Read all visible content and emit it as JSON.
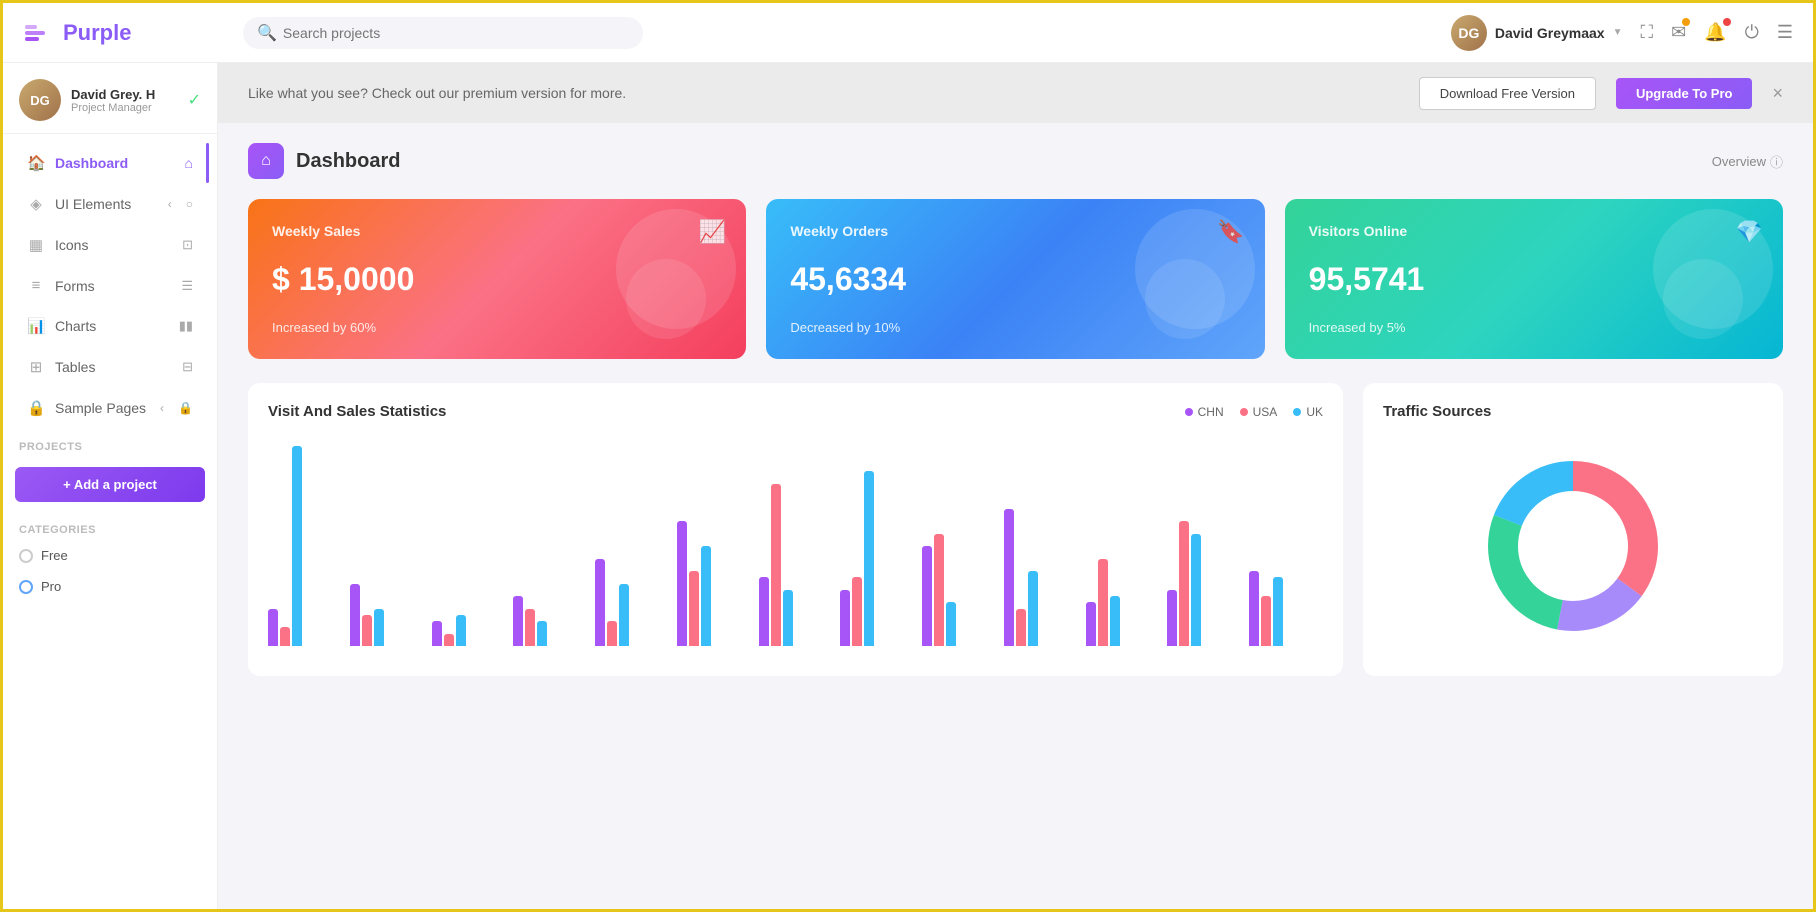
{
  "app": {
    "name": "Purple",
    "tagline": "Dashboard"
  },
  "topbar": {
    "search_placeholder": "Search projects",
    "user": {
      "name": "David Greymaax",
      "initials": "DG"
    },
    "icons": [
      "expand",
      "mail",
      "bell",
      "power",
      "menu"
    ]
  },
  "sidebar": {
    "user": {
      "name": "David Grey. H",
      "role": "Project Manager",
      "initials": "DG"
    },
    "nav_items": [
      {
        "label": "Dashboard",
        "icon": "🏠",
        "active": true
      },
      {
        "label": "UI Elements",
        "icon": "◈",
        "has_arrow": true
      },
      {
        "label": "Icons",
        "icon": "▦"
      },
      {
        "label": "Forms",
        "icon": "≡"
      },
      {
        "label": "Charts",
        "icon": "📊"
      },
      {
        "label": "Tables",
        "icon": "⊞"
      },
      {
        "label": "Sample Pages",
        "icon": "🔒",
        "has_arrow": true
      }
    ],
    "projects_label": "Projects",
    "add_project_label": "+ Add a project",
    "categories_label": "Categories",
    "categories": [
      {
        "label": "Free",
        "type": "radio"
      },
      {
        "label": "Pro",
        "type": "radio-blue"
      }
    ]
  },
  "banner": {
    "text": "Like what you see? Check out our premium version for more.",
    "download_label": "Download Free Version",
    "upgrade_label": "Upgrade To Pro"
  },
  "dashboard": {
    "title": "Dashboard",
    "overview_label": "Overview",
    "stat_cards": [
      {
        "label": "Weekly Sales",
        "value": "$ 15,0000",
        "change": "Increased by 60%",
        "color": "pink",
        "icon": "📈"
      },
      {
        "label": "Weekly Orders",
        "value": "45,6334",
        "change": "Decreased by 10%",
        "color": "blue",
        "icon": "🔖"
      },
      {
        "label": "Visitors Online",
        "value": "95,5741",
        "change": "Increased by 5%",
        "color": "teal",
        "icon": "💎"
      }
    ],
    "visit_stats": {
      "title": "Visit And Sales Statistics",
      "legend": [
        {
          "label": "CHN",
          "color": "#a855f7"
        },
        {
          "label": "USA",
          "color": "#fb7185"
        },
        {
          "label": "UK",
          "color": "#38bdf8"
        }
      ],
      "bars": [
        {
          "chn": 30,
          "usa": 15,
          "uk": 160
        },
        {
          "chn": 50,
          "usa": 25,
          "uk": 30
        },
        {
          "chn": 20,
          "usa": 10,
          "uk": 25
        },
        {
          "chn": 40,
          "usa": 30,
          "uk": 20
        },
        {
          "chn": 70,
          "usa": 20,
          "uk": 50
        },
        {
          "chn": 100,
          "usa": 60,
          "uk": 80
        },
        {
          "chn": 55,
          "usa": 130,
          "uk": 45
        },
        {
          "chn": 45,
          "usa": 55,
          "uk": 140
        },
        {
          "chn": 80,
          "usa": 90,
          "uk": 35
        },
        {
          "chn": 110,
          "usa": 30,
          "uk": 60
        },
        {
          "chn": 35,
          "usa": 70,
          "uk": 40
        },
        {
          "chn": 45,
          "usa": 100,
          "uk": 90
        },
        {
          "chn": 60,
          "usa": 40,
          "uk": 55
        }
      ]
    },
    "traffic_sources": {
      "title": "Traffic Sources",
      "segments": [
        {
          "color": "#fb7185",
          "percent": 35
        },
        {
          "color": "#a78bfa",
          "percent": 18
        },
        {
          "color": "#34d399",
          "percent": 28
        },
        {
          "color": "#38bdf8",
          "percent": 19
        }
      ]
    }
  }
}
